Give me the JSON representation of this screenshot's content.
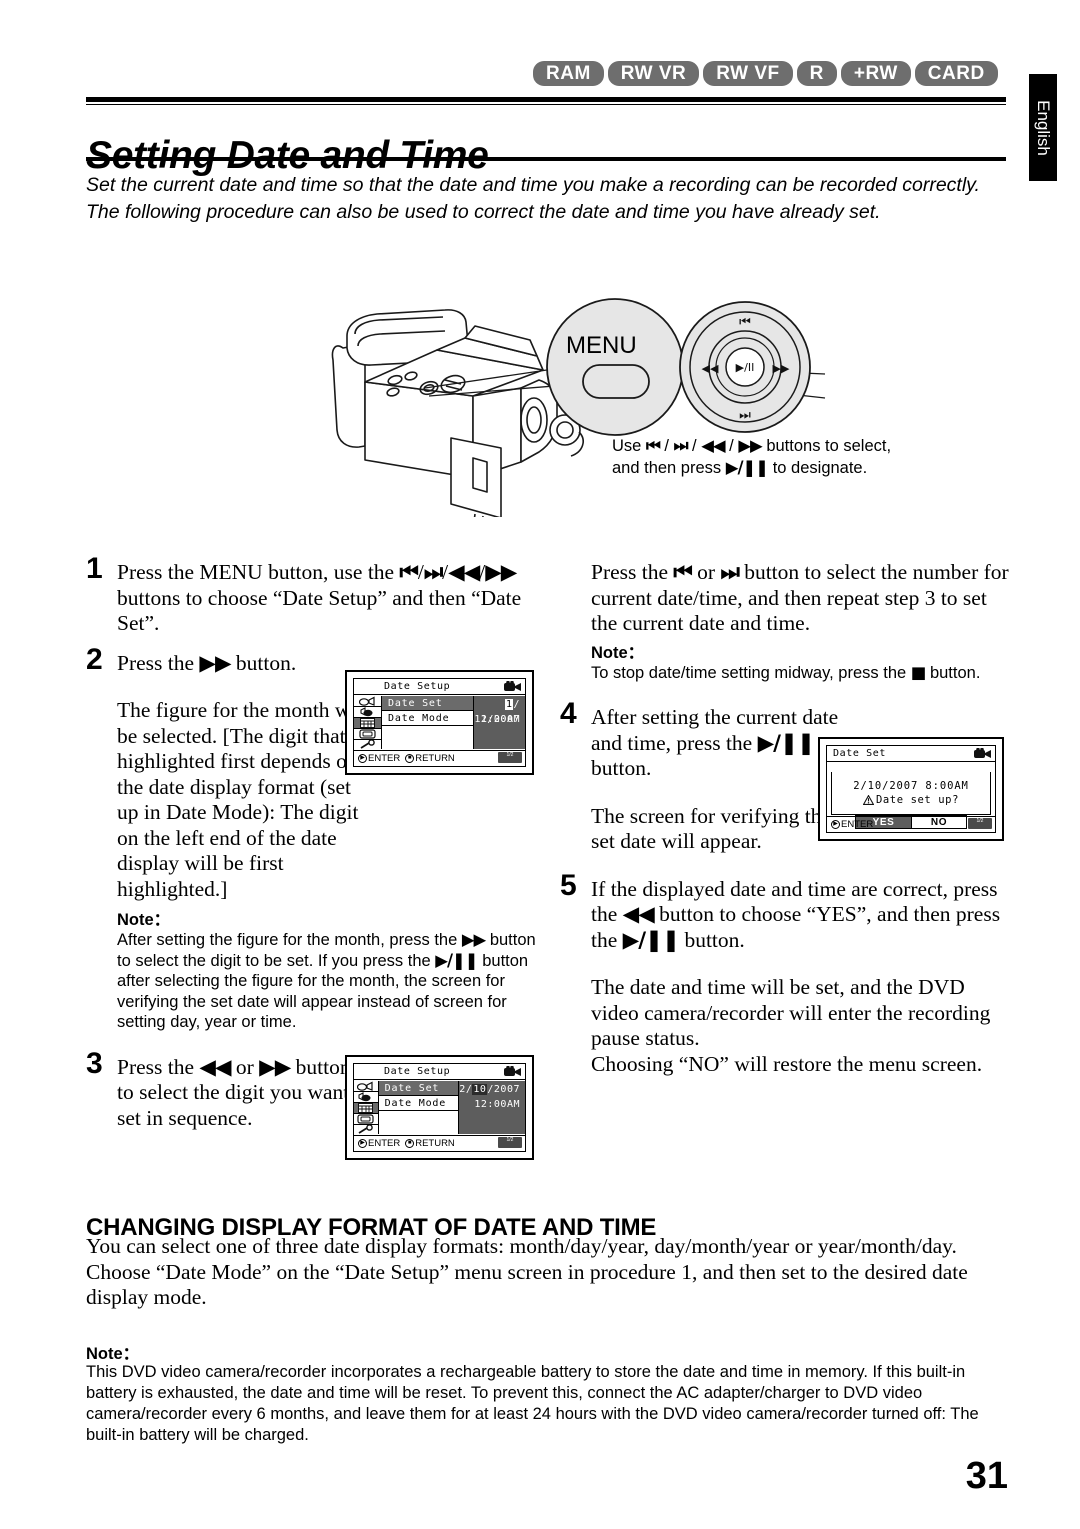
{
  "media_badges": [
    "RAM",
    "RW VR",
    "RW VF",
    "R",
    "+RW",
    "CARD"
  ],
  "language_tab": "English",
  "page_title": "Setting Date and Time",
  "intro": {
    "line1": "Set the current date and time so that the date and time you make a recording can be recorded correctly.",
    "line2": "The following procedure can also be used to correct the date and time you have already set."
  },
  "figure": {
    "menu_label": "MENU",
    "caption": "Use ⏮ / ⏭ / ◀◀ / ▶▶ buttons to select, and then press ▶/❙❙ to designate.",
    "dpad_icons": {
      "up": "skip-back-icon",
      "down": "skip-forward-icon",
      "left": "rewind-icon",
      "right": "fast-forward-icon",
      "center": "play-pause-icon"
    }
  },
  "steps": {
    "s1": {
      "num": "1",
      "text_a": "Press the MENU button, use the ",
      "icon_a": "◀◀",
      "text_b": " buttons to choose “Date Setup” and then “Date Set”."
    },
    "s2": {
      "num": "2",
      "text_a": "Press the ",
      "text_b": " button.",
      "para1": "The figure for the month will be selected. [The digit that is highlighted first depends on the date display format (set up in Date Mode): The digit on the left end of the date display will be first highlighted.]",
      "note_label": "Note：",
      "note_a": "After setting the figure for the month, press the ",
      "note_b": " button to select the digit to be set. If you press the ",
      "note_c": " button after selecting the figure for the month, the screen for verifying the set date will appear instead of screen for setting day, year or time."
    },
    "s3": {
      "num": "3",
      "text_a": "Press the ",
      "text_mid": " or ",
      "text_b": " button to select the digit you want to set in sequence."
    },
    "s3_right": {
      "text_a": "Press the ",
      "text_mid": " or ",
      "text_b": " button to select the number for current date/time, and then repeat step 3 to set the current date and time.",
      "note_label": "Note：",
      "note_a": "To stop date/time setting midway, press the ",
      "note_b": " button."
    },
    "s4": {
      "num": "4",
      "text_a": "After setting the current date and time, press the ",
      "text_b": " button.",
      "para1": "The screen for verifying the set date will appear."
    },
    "s5": {
      "num": "5",
      "text_a": "If the displayed date and time are correct, press the ",
      "text_mid": " button to choose “YES”, and then press the ",
      "text_b": " button.",
      "para1": "The date and time will be set, and the DVD video camera/recorder will enter the recording pause status.",
      "para2": "Choosing “NO” will restore the menu screen."
    }
  },
  "lcd1": {
    "title": "Date Setup",
    "rows": [
      "Date Set",
      "Date Mode"
    ],
    "value_date_prefix": "1",
    "value_date_rest": "/ 1/2007",
    "value_time": "12:00AM",
    "footer_enter": "ENTER",
    "footer_return": "RETURN",
    "corner_tag": "1/2"
  },
  "lcd2": {
    "title": "Date Setup",
    "rows": [
      "Date Set",
      "Date Mode"
    ],
    "value_date_pre": "2/",
    "value_date_hl": "10",
    "value_date_post": "/2007",
    "value_time": "12:00AM",
    "footer_enter": "ENTER",
    "footer_return": "RETURN",
    "corner_tag": "1/2"
  },
  "lcd3": {
    "title": "Date Set",
    "datetime": "2/10/2007  8:00AM",
    "question": "Date set up?",
    "warning_icon": "warning-triangle-icon",
    "yes": "YES",
    "no": "NO",
    "footer_enter": "ENTER",
    "corner_tag": "1/2"
  },
  "section": {
    "heading": "CHANGING DISPLAY FORMAT OF DATE AND TIME",
    "body": "You can select one of three date display formats: month/day/year, day/month/year or year/month/day. Choose “Date Mode” on the “Date Setup” menu screen in procedure 1, and then set to the desired date display mode."
  },
  "final_note": {
    "label": "Note：",
    "body": "This DVD video camera/recorder incorporates a rechargeable battery to store the date and time in memory. If this built-in battery is exhausted, the date and time will be reset. To prevent this, connect the AC adapter/charger to DVD video camera/recorder every 6 months, and leave them for at least 24 hours with the DVD video camera/recorder turned off: The built-in battery will be charged."
  },
  "page_number": "31"
}
